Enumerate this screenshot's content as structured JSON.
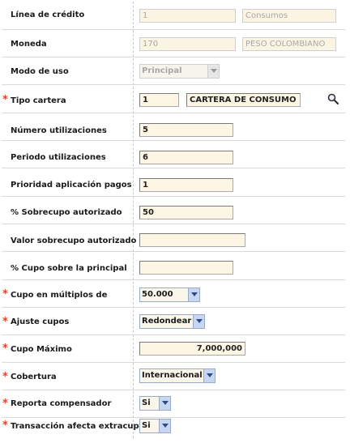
{
  "rows": [
    {
      "label": "Línea de crédito",
      "required": false,
      "code": "1",
      "text": "Consumos"
    },
    {
      "label": "Moneda",
      "required": false,
      "code": "170",
      "text": "PESO COLOMBIANO"
    },
    {
      "label": "Modo de uso",
      "required": false,
      "selected": "Principal"
    },
    {
      "label": "Tipo cartera",
      "required": true,
      "code": "1",
      "text": "CARTERA DE CONSUMO",
      "icon": "search-icon"
    },
    {
      "label": "Número utilizaciones",
      "required": false,
      "value": "5"
    },
    {
      "label": "Periodo utilizaciones",
      "required": false,
      "value": "6"
    },
    {
      "label": "Prioridad aplicación pagos",
      "required": false,
      "value": "1"
    },
    {
      "label": "% Sobrecupo autorizado",
      "required": false,
      "value": "50"
    },
    {
      "label": "Valor sobrecupo autorizado",
      "required": false,
      "value": ""
    },
    {
      "label": "% Cupo sobre la principal",
      "required": false,
      "value": ""
    },
    {
      "label": "Cupo en múltiplos de",
      "required": true,
      "selected": "50.000"
    },
    {
      "label": "Ajuste cupos",
      "required": true,
      "selected": "Redondear"
    },
    {
      "label": "Cupo Máximo",
      "required": true,
      "value": "7,000,000"
    },
    {
      "label": "Cobertura",
      "required": true,
      "selected": "Internacional"
    },
    {
      "label": "Reporta compensador",
      "required": true,
      "selected": "Si"
    },
    {
      "label": "Transacción afecta extracupo",
      "required": true,
      "selected": "Si"
    }
  ],
  "required_marker": "*",
  "colors": {
    "required": "#e2442a",
    "field_bg": "#fdf6e4",
    "select_arrow_bg": "#c7d6f2"
  }
}
